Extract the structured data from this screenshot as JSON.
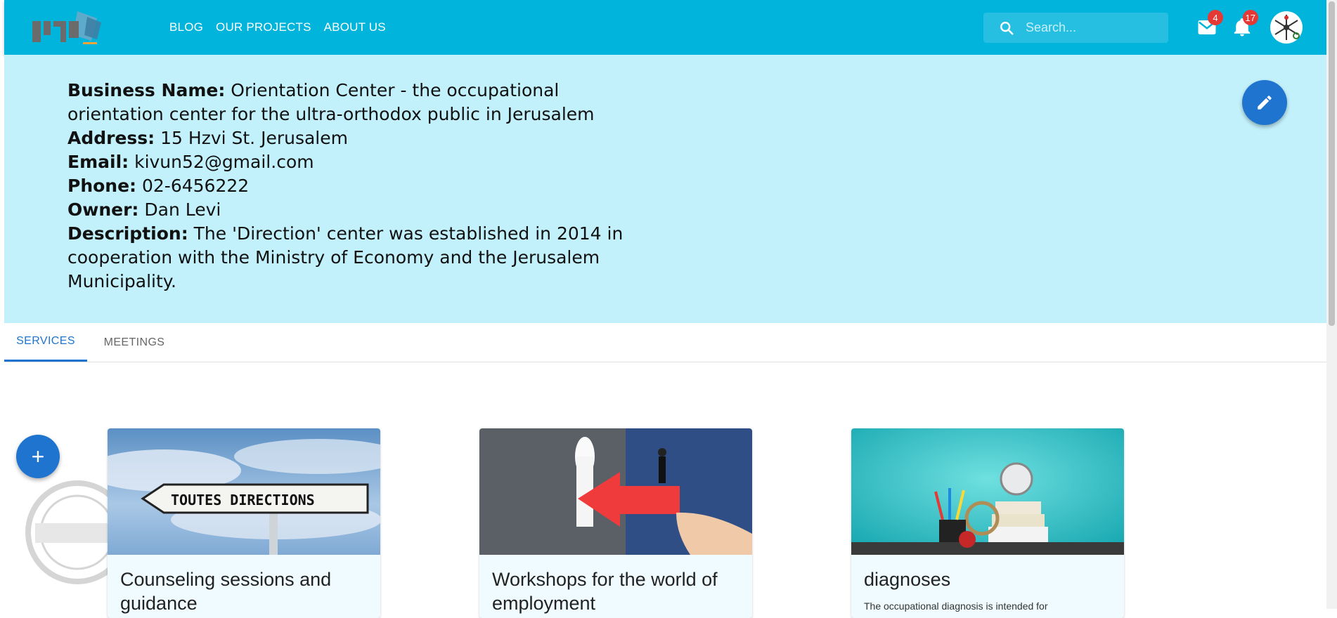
{
  "nav": {
    "blog": "BLOG",
    "projects": "OUR PROJECTS",
    "about": "ABOUT US"
  },
  "search": {
    "placeholder": "Search..."
  },
  "notifications": {
    "mail_count": "4",
    "bell_count": "17"
  },
  "business": {
    "name_label": "Business Name:",
    "name": "Orientation Center - the occupational orientation center for the ultra-orthodox public in Jerusalem",
    "address_label": "Address:",
    "address": "15 Hzvi St. Jerusalem",
    "email_label": "Email:",
    "email": "kivun52@gmail.com",
    "phone_label": "Phone:",
    "phone": "02-6456222",
    "owner_label": "Owner:",
    "owner": "Dan Levi",
    "description_label": "Description:",
    "description": "The 'Direction' center was established in 2014 in cooperation with the Ministry of Economy and the Jerusalem Municipality."
  },
  "tabs": [
    {
      "label": "SERVICES"
    },
    {
      "label": "MEETINGS"
    }
  ],
  "add_button": "+",
  "cards": [
    {
      "title": "Counseling sessions and guidance",
      "description": "",
      "sign_text": "TOUTES DIRECTIONS"
    },
    {
      "title": "Workshops for the world of employment",
      "description": ""
    },
    {
      "title": "diagnoses",
      "description": "The occupational diagnosis is intended for"
    }
  ],
  "colors": {
    "appbar": "#00b4dc",
    "info_panel": "#c2f1fc",
    "primary": "#1f74d0",
    "badge": "#e53935"
  }
}
